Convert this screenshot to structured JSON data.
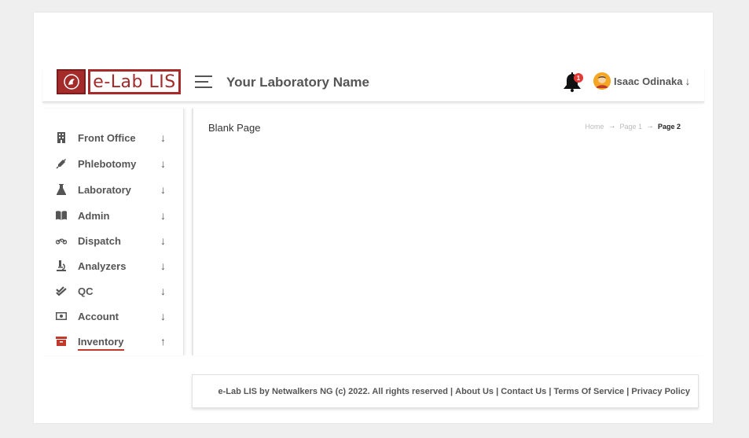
{
  "header": {
    "logo_text": "e-Lab LIS",
    "lab_name": "Your Laboratory Name",
    "notification_count": "1",
    "user_name": "Isaac Odinaka",
    "user_menu_arrow": "↓"
  },
  "sidebar": {
    "items": [
      {
        "label": "Front Office",
        "icon": "building-icon",
        "arrow": "↓"
      },
      {
        "label": "Phlebotomy",
        "icon": "syringe-icon",
        "arrow": "↓"
      },
      {
        "label": "Laboratory",
        "icon": "flask-icon",
        "arrow": "↓"
      },
      {
        "label": "Admin",
        "icon": "book-icon",
        "arrow": "↓"
      },
      {
        "label": "Dispatch",
        "icon": "motorcycle-icon",
        "arrow": "↓"
      },
      {
        "label": "Analyzers",
        "icon": "microscope-icon",
        "arrow": "↓"
      },
      {
        "label": "QC",
        "icon": "double-check-icon",
        "arrow": "↓"
      },
      {
        "label": "Account",
        "icon": "money-bill-icon",
        "arrow": "↓"
      },
      {
        "label": "Inventory",
        "icon": "archive-box-icon",
        "arrow": "↑"
      }
    ]
  },
  "main": {
    "title": "Blank Page",
    "breadcrumb": [
      "Home",
      "Page 1",
      "Page 2"
    ],
    "breadcrumb_sep": "→"
  },
  "footer": {
    "copyright": "e-Lab LIS by Netwalkers NG (c) 2022. All rights reserved",
    "divider": " | ",
    "links": [
      "About Us",
      "Contact Us",
      "Terms Of Service",
      "Privacy Policy"
    ]
  },
  "colors": {
    "brand": "#a52a2a",
    "active_underline": "#c0392b",
    "badge": "#e53935",
    "avatar": "#f5a623"
  }
}
